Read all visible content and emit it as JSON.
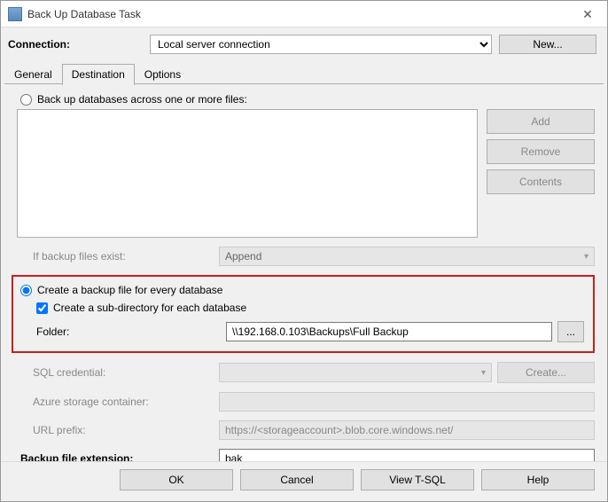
{
  "window": {
    "title": "Back Up Database Task"
  },
  "connection": {
    "label": "Connection:",
    "value": "Local server connection",
    "new_button": "New..."
  },
  "tabs": {
    "general": "General",
    "destination": "Destination",
    "options": "Options"
  },
  "radios": {
    "across_files": "Back up databases across one or more files:",
    "per_db": "Create a backup file for every database"
  },
  "side_buttons": {
    "add": "Add",
    "remove": "Remove",
    "contents": "Contents"
  },
  "fields": {
    "if_exist_label": "If backup files exist:",
    "if_exist_value": "Append",
    "subdir_label": "Create a sub-directory for each database",
    "folder_label": "Folder:",
    "folder_value": "\\\\192.168.0.103\\Backups\\Full Backup",
    "browse": "...",
    "sql_cred_label": "SQL credential:",
    "create_btn": "Create...",
    "azure_label": "Azure storage container:",
    "url_label": "URL prefix:",
    "url_value": "https://<storageaccount>.blob.core.windows.net/",
    "ext_label": "Backup file extension:",
    "ext_value": "bak"
  },
  "footer": {
    "ok": "OK",
    "cancel": "Cancel",
    "tsql": "View T-SQL",
    "help": "Help"
  }
}
